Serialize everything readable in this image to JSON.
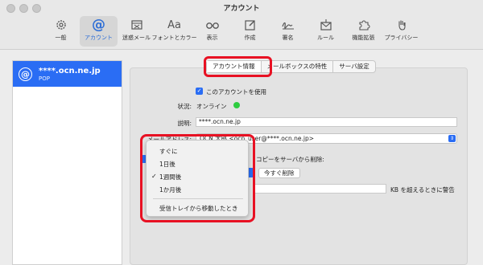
{
  "window": {
    "title": "アカウント"
  },
  "toolbar": {
    "items": [
      {
        "label": "一般",
        "icon": "gear-icon"
      },
      {
        "label": "アカウント",
        "icon": "at-sign-icon",
        "active": true
      },
      {
        "label": "迷惑メール",
        "icon": "junk-mail-icon"
      },
      {
        "label": "フォントとカラー",
        "icon": "font-icon",
        "glyph": "Aa"
      },
      {
        "label": "表示",
        "icon": "glasses-icon"
      },
      {
        "label": "作成",
        "icon": "compose-icon"
      },
      {
        "label": "署名",
        "icon": "signature-icon"
      },
      {
        "label": "ルール",
        "icon": "rules-icon"
      },
      {
        "label": "機能拡張",
        "icon": "puzzle-icon"
      },
      {
        "label": "プライバシー",
        "icon": "hand-icon"
      }
    ]
  },
  "sidebar": {
    "account": {
      "icon_glyph": "@",
      "name": "****.ocn.ne.jp",
      "type": "POP"
    }
  },
  "tabs": [
    {
      "label": "アカウント情報",
      "active": true
    },
    {
      "label": "メールボックスの特性"
    },
    {
      "label": "サーバ設定"
    }
  ],
  "form": {
    "enable_account": {
      "label": "このアカウントを使用",
      "checked": true
    },
    "status": {
      "label": "状況:",
      "value": "オンライン",
      "color": "#2ecc40"
    },
    "description": {
      "label": "説明:",
      "value": "****.ocn.ne.jp"
    },
    "email": {
      "label": "メールアドレス:",
      "value": "OCN 太郎 <ocn_user@****.ocn.ne.jp>"
    },
    "remove_copy": {
      "label": "コピーをサーバから削除:",
      "checked": true
    },
    "remove_now_button": "今すぐ削除",
    "size_limit": {
      "suffix": "KB を超えるときに警告"
    }
  },
  "dropdown": {
    "items": [
      "すぐに",
      "1日後",
      "1週間後",
      "1か月後"
    ],
    "selected": "1週間後",
    "extra_item": "受信トレイから移動したとき"
  },
  "highlight_color": "#e81123",
  "accent_color": "#2a6df4"
}
